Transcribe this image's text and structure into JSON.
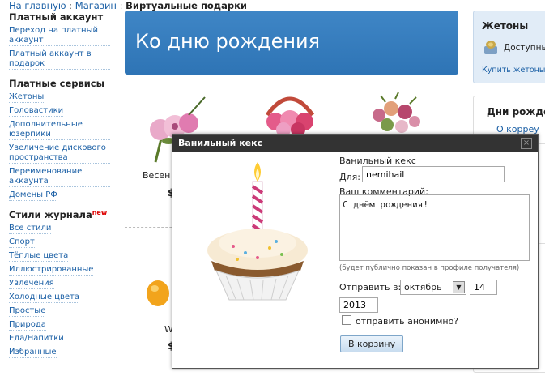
{
  "breadcrumb": {
    "home": "На главную",
    "sep1": ":",
    "shop": "Магазин",
    "sep2": ":",
    "current": "Виртуальные подарки"
  },
  "sidebar": {
    "paid_account_heading": "Платный аккаунт",
    "paid_account_links": [
      "Переход на платный аккаунт",
      "Платный аккаунт в подарок"
    ],
    "paid_services_heading": "Платные сервисы",
    "paid_services_links": [
      "Жетоны",
      "Головастики",
      "Дополнительные юзерпики",
      "Увеличение дискового пространства",
      "Переименование аккаунта",
      "Домены РФ"
    ],
    "styles_heading": "Стили журнала",
    "styles_badge": "new",
    "styles_links": [
      "Все стили",
      "Спорт",
      "Тёплые цвета",
      "Иллюстрированные",
      "Увлечения",
      "Холодные цвета",
      "Простые",
      "Природа",
      "Еда/Напитки",
      "Избранные"
    ]
  },
  "banner": {
    "title": "Ко дню рождения"
  },
  "tokens": {
    "title": "Жетоны",
    "available": "Доступны",
    "link": "Купить жетоны"
  },
  "birthdays": {
    "title": "Дни рожде",
    "link": "О корреу"
  },
  "gifts": {
    "gift1_label": "Весен",
    "gift1_price": "$",
    "gift2_label": "W",
    "gift2_price": "$"
  },
  "modal": {
    "title": "Ванильный кекс",
    "close": "×",
    "gift_name": "Ванильный кекс",
    "for_label": "Для:",
    "for_value": "nemihail",
    "comment_label": "Ваш комментарий:",
    "comment_value": "С днём рождения!",
    "hint": "(будет публично показан в профиле получателя)",
    "send_label": "Отправить в:",
    "month": "октябрь",
    "day": "14",
    "year": "2013",
    "anon_label": "отправить анонимно?",
    "anon_checked": false,
    "cart_button": "В корзину"
  }
}
